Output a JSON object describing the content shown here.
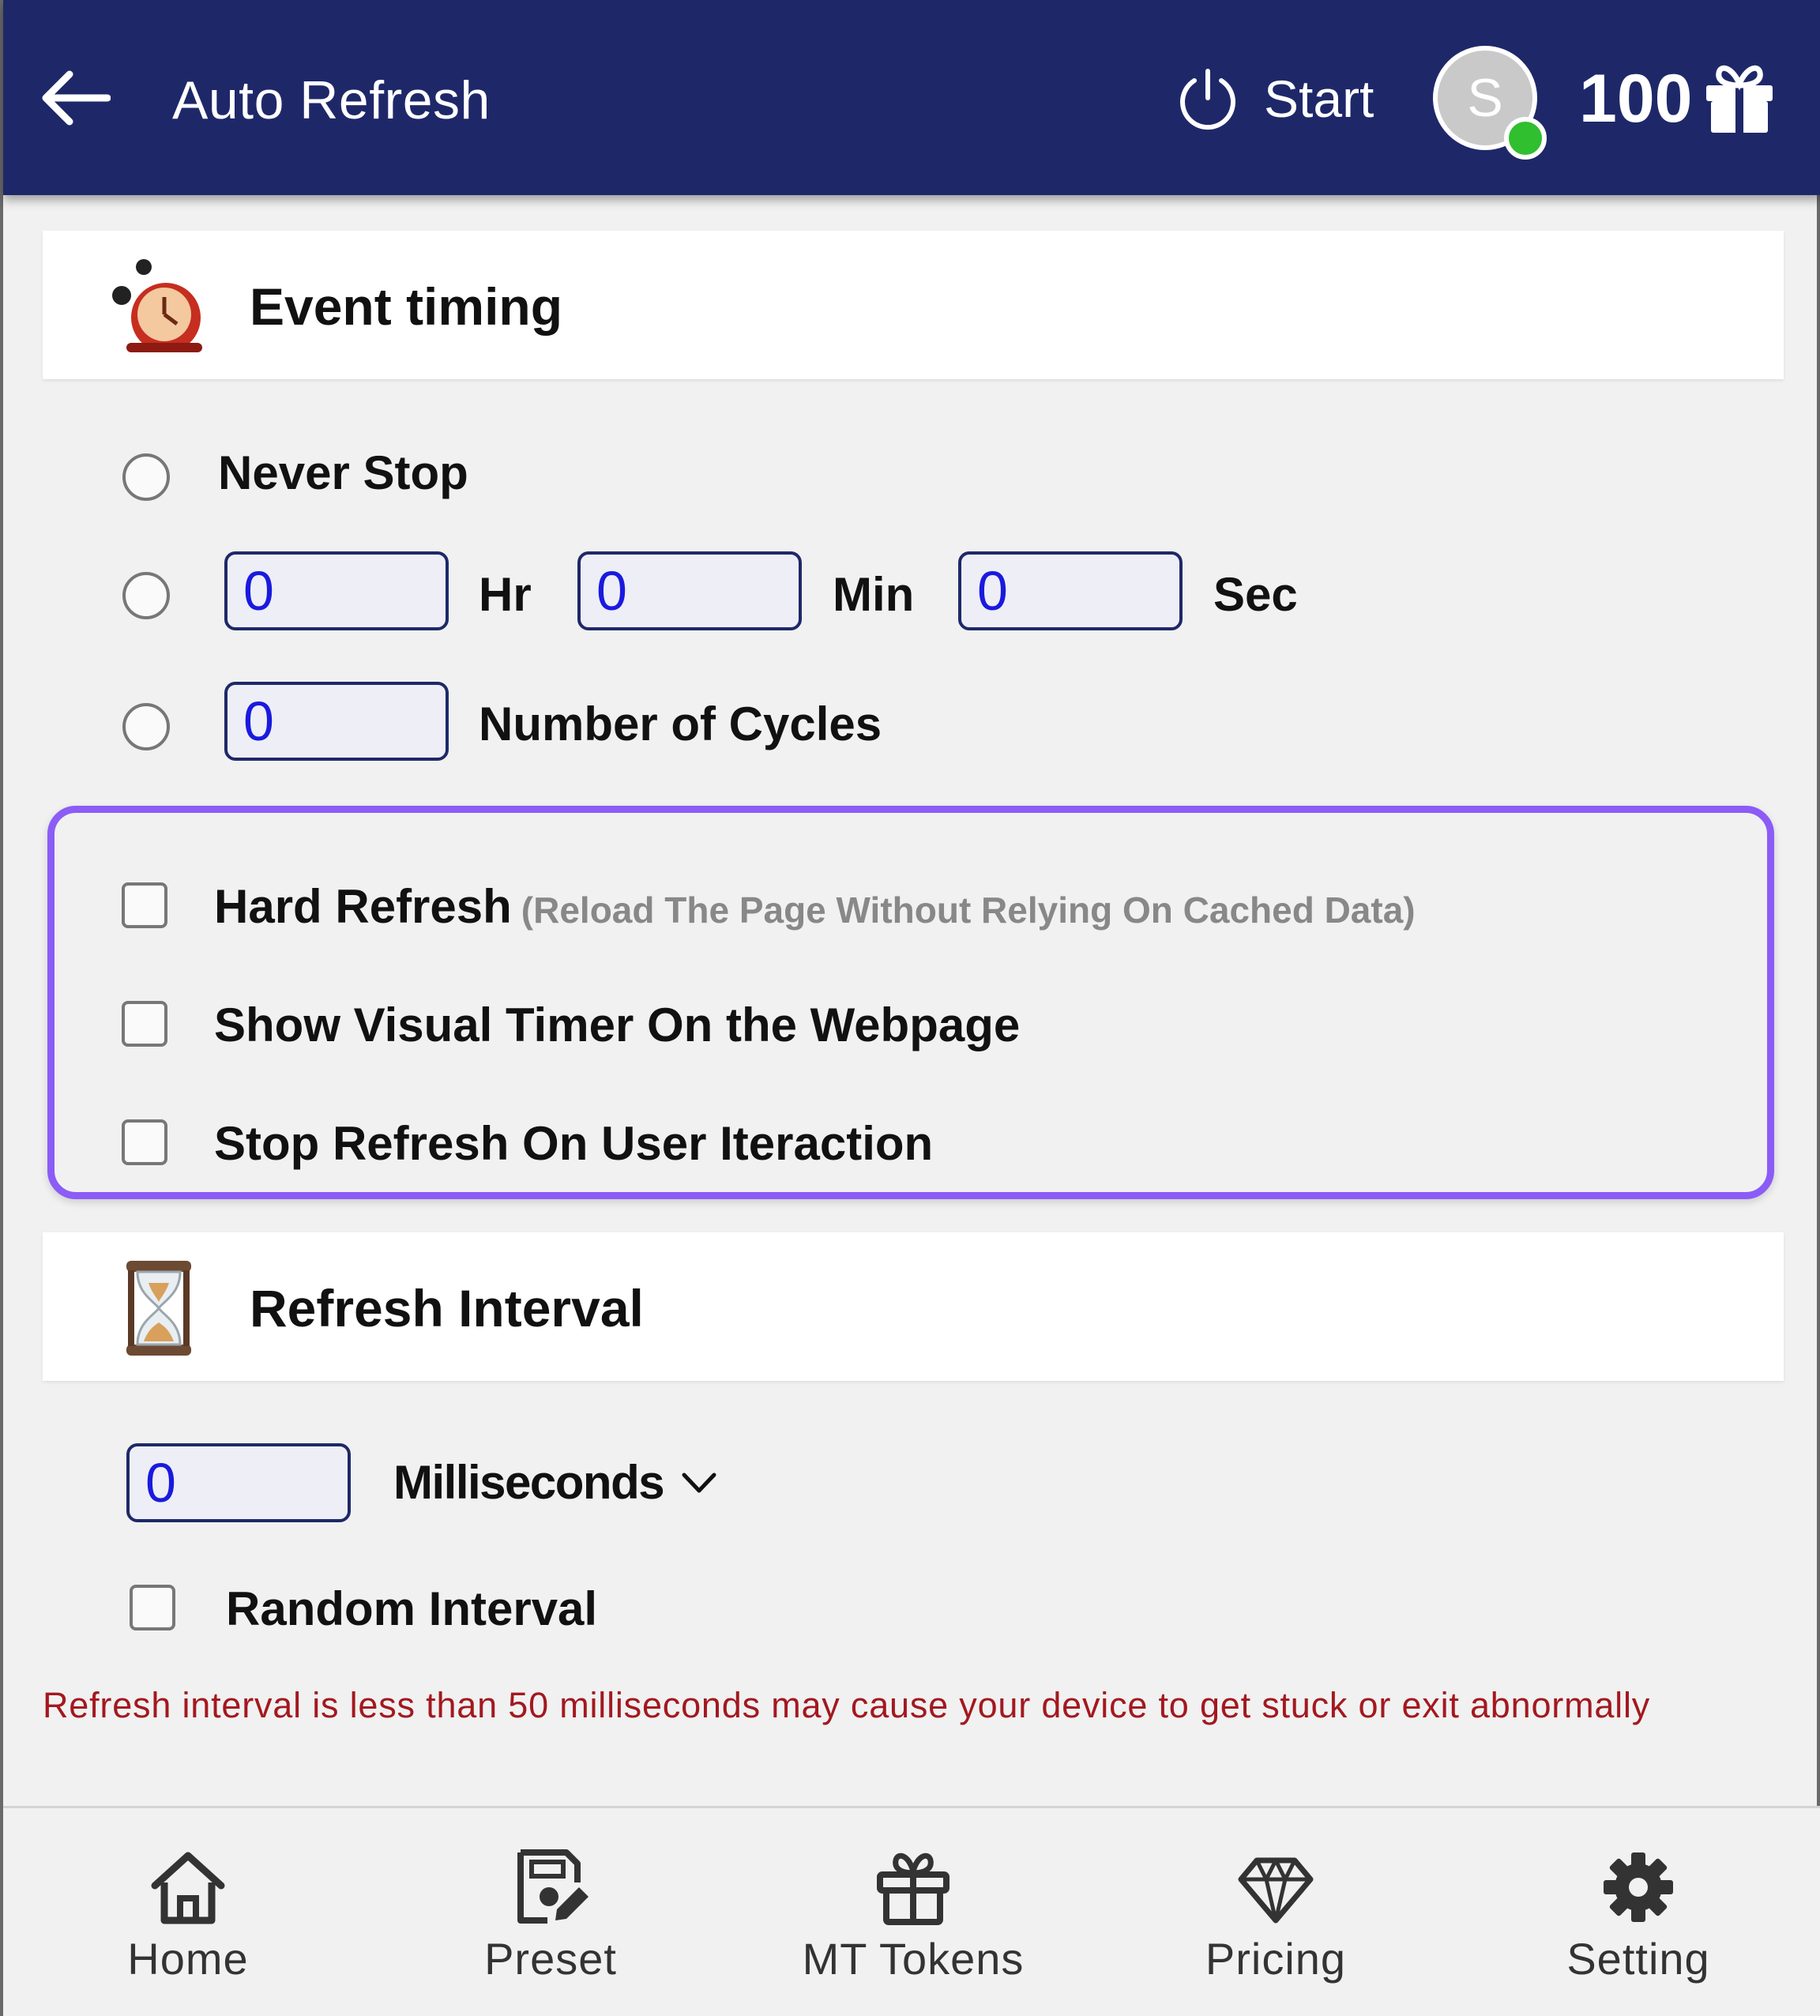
{
  "header": {
    "title": "Auto Refresh",
    "start_label": "Start",
    "avatar_initial": "S",
    "token_count": "100"
  },
  "event_timing": {
    "title": "Event timing",
    "never_stop_label": "Never Stop",
    "hours_value": "0",
    "hours_unit": "Hr",
    "minutes_value": "0",
    "minutes_unit": "Min",
    "seconds_value": "0",
    "seconds_unit": "Sec",
    "cycles_value": "0",
    "cycles_label": "Number of Cycles"
  },
  "options": {
    "hard_refresh_label": "Hard Refresh",
    "hard_refresh_hint": "(Reload The Page Without Relying On Cached Data)",
    "visual_timer_label": "Show Visual Timer On the Webpage",
    "stop_on_interaction_label": "Stop Refresh On User Iteraction"
  },
  "refresh_interval": {
    "title": "Refresh Interval",
    "value": "0",
    "unit": "Milliseconds",
    "random_label": "Random Interval",
    "warning": "Refresh interval is less than 50 milliseconds may cause your device to get stuck or exit abnormally"
  },
  "nav": {
    "home": "Home",
    "preset": "Preset",
    "tokens": "MT Tokens",
    "pricing": "Pricing",
    "setting": "Setting"
  },
  "colors": {
    "header_bg": "#1e2869",
    "accent_border": "#8b5cf6",
    "input_text": "#1a1adf",
    "warning_text": "#a3181f",
    "online": "#2fbf2f"
  }
}
